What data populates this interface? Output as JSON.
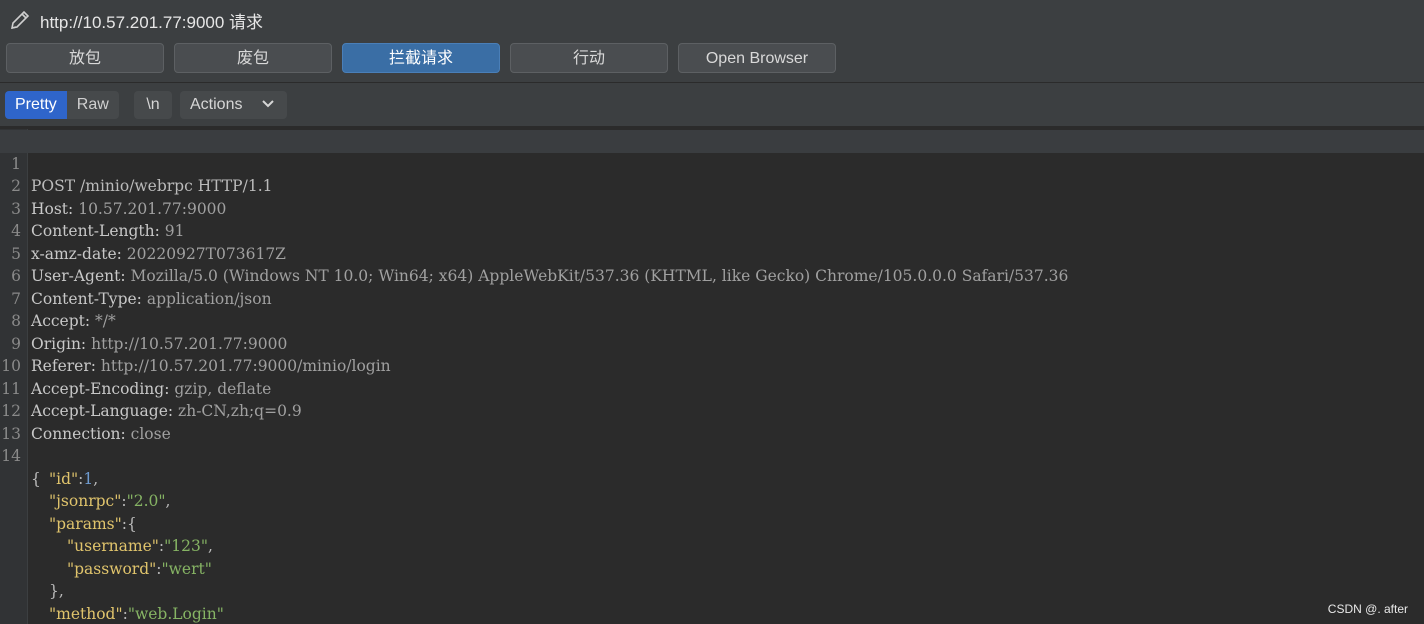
{
  "title": "http://10.57.201.77:9000 请求",
  "buttons": {
    "forward": "放包",
    "drop": "废包",
    "intercept": "拦截请求",
    "action": "行动",
    "open_browser": "Open Browser"
  },
  "tabs": {
    "pretty": "Pretty",
    "raw": "Raw",
    "newline": "\\n",
    "actions": "Actions"
  },
  "request_line": "POST /minio/webrpc HTTP/1.1",
  "headers": [
    {
      "name": "Host:",
      "value": "10.57.201.77:9000"
    },
    {
      "name": "Content-Length:",
      "value": "91"
    },
    {
      "name": "x-amz-date:",
      "value": "20220927T073617Z"
    },
    {
      "name": "User-Agent:",
      "value": "Mozilla/5.0 (Windows NT 10.0; Win64; x64) AppleWebKit/537.36 (KHTML, like Gecko) Chrome/105.0.0.0 Safari/537.36"
    },
    {
      "name": "Content-Type:",
      "value": "application/json"
    },
    {
      "name": "Accept:",
      "value": "*/*"
    },
    {
      "name": "Origin:",
      "value": "http://10.57.201.77:9000"
    },
    {
      "name": "Referer:",
      "value": "http://10.57.201.77:9000/minio/login"
    },
    {
      "name": "Accept-Encoding:",
      "value": "gzip, deflate"
    },
    {
      "name": "Accept-Language:",
      "value": "zh-CN,zh;q=0.9"
    },
    {
      "name": "Connection:",
      "value": "close"
    }
  ],
  "line_numbers": [
    "1",
    "2",
    "3",
    "4",
    "5",
    "6",
    "7",
    "8",
    "9",
    "10",
    "11",
    "12",
    "13",
    "14"
  ],
  "body": {
    "open": "{",
    "id_key": "\"id\"",
    "id_val": "1",
    "jsonrpc_key": "\"jsonrpc\"",
    "jsonrpc_val": "\"2.0\"",
    "params_key": "\"params\"",
    "username_key": "\"username\"",
    "username_val": "\"123\"",
    "password_key": "\"password\"",
    "password_val": "\"wert\"",
    "params_close": "},",
    "method_key": "\"method\"",
    "method_val": "\"web.Login\"",
    "close": "}"
  },
  "watermark": "CSDN @. after"
}
